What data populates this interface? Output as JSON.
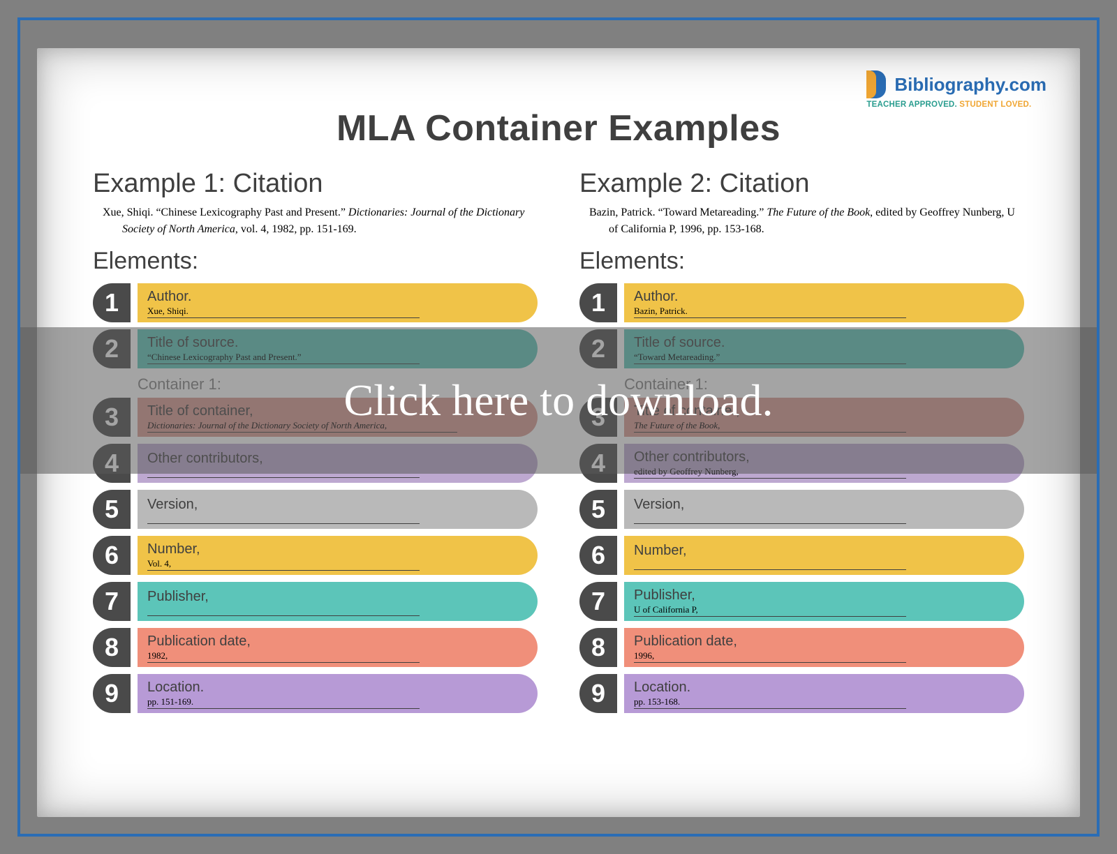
{
  "brand": {
    "name": "Bibliography.com",
    "tagline_a": "TEACHER APPROVED.",
    "tagline_b": "STUDENT LOVED."
  },
  "title": "MLA Container Examples",
  "overlay_text": "Click here to download.",
  "labels": {
    "elements": "Elements:",
    "container1": "Container 1:"
  },
  "element_labels": {
    "author": "Author.",
    "title_source": "Title of source.",
    "title_container": "Title of container,",
    "other_contributors": "Other contributors,",
    "version": "Version,",
    "number": "Number,",
    "publisher": "Publisher,",
    "pub_date": "Publication date,",
    "location": "Location."
  },
  "numbers": {
    "n1": "1",
    "n2": "2",
    "n3": "3",
    "n4": "4",
    "n5": "5",
    "n6": "6",
    "n7": "7",
    "n8": "8",
    "n9": "9"
  },
  "ex1": {
    "heading": "Example 1: Citation",
    "citation_pre": "Xue, Shiqi. “Chinese Lexicography Past and Present.” ",
    "citation_ital": "Dictionaries: Journal of the Dictionary Society of North America",
    "citation_post": ", vol. 4, 1982, pp. 151-169.",
    "values": {
      "author": "Xue, Shiqi.",
      "title_source": "“Chinese Lexicography Past and Present.”",
      "title_container": "Dictionaries: Journal of the Dictionary Society of North America,",
      "other_contributors": "",
      "version": "",
      "number": "Vol. 4,",
      "publisher": "",
      "pub_date": "1982,",
      "location": "pp. 151-169."
    }
  },
  "ex2": {
    "heading": "Example 2: Citation",
    "citation_pre": "Bazin, Patrick. “Toward Metareading.” ",
    "citation_ital": "The Future of the Book",
    "citation_post": ", edited by Geoffrey Nunberg, U of California P, 1996, pp. 153-168.",
    "values": {
      "author": "Bazin, Patrick.",
      "title_source": "“Toward Metareading.”",
      "title_container": "The Future of the Book,",
      "other_contributors": "edited by Geoffrey Nunberg,",
      "version": "",
      "number": "",
      "publisher": "U of California P,",
      "pub_date": "1996,",
      "location": "pp. 153-168."
    }
  }
}
